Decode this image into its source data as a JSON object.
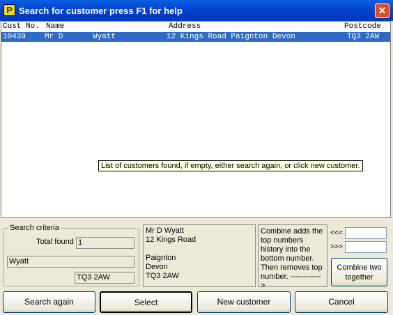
{
  "window": {
    "title": "Search for customer press F1 for help",
    "icon": "P",
    "close_icon": "close-icon"
  },
  "grid": {
    "headers": {
      "cust_no": "Cust No.",
      "name": "Name",
      "address": "Address",
      "postcode": "Postcode"
    },
    "rows": [
      {
        "cust_no": "10439",
        "title": "Mr D",
        "surname": "Wyatt",
        "address": "12 Kings Road  Paignton Devon",
        "postcode": "TQ3 2AW"
      }
    ],
    "tooltip": "List of customers found, if empty, either search again, or click new customer."
  },
  "criteria": {
    "legend": "Search criteria",
    "total_found_label": "Total found",
    "total_found_value": "1",
    "name_value": "Wyatt",
    "postcode_value": "TQ3 2AW"
  },
  "address_panel": {
    "lines": [
      "Mr D Wyatt",
      "12 Kings Road",
      "",
      "Paignton",
      "Devon",
      "TQ3 2AW"
    ]
  },
  "combine": {
    "info": "Combine adds the top numbers history into the bottom number.  Then removes top number. ------------>",
    "top_arrow": "<<<",
    "bottom_arrow": ">>>",
    "top_value": "",
    "bottom_value": "",
    "button_label": "Combine two together"
  },
  "buttons": {
    "search_again": "Search again",
    "select": "Select",
    "new_customer": "New customer",
    "cancel": "Cancel"
  }
}
